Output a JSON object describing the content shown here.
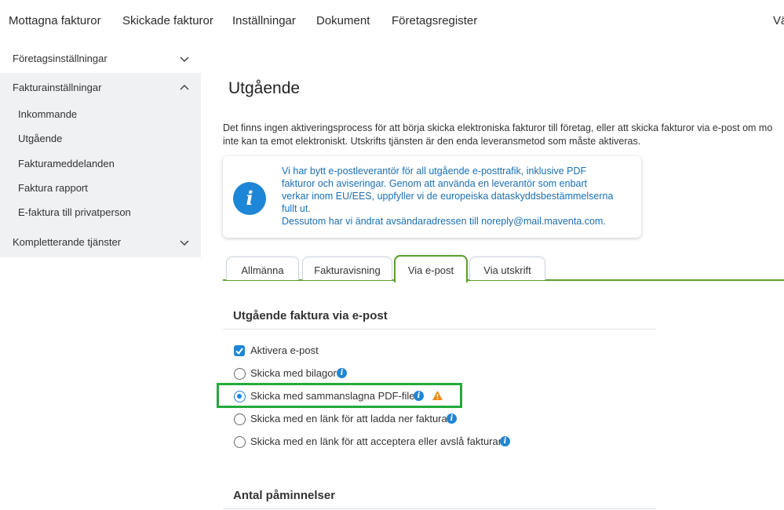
{
  "topnav": {
    "items": [
      "Mottagna fakturor",
      "Skickade fakturor",
      "Inställningar",
      "Dokument",
      "Företagsregister",
      "Vä"
    ]
  },
  "sidebar": {
    "groups": [
      {
        "label": "Företagsinställningar",
        "expanded": false
      },
      {
        "label": "Fakturainställningar",
        "expanded": true
      },
      {
        "label": "Kompletterande tjänster",
        "expanded": false
      }
    ],
    "sub_items": [
      "Inkommande",
      "Utgående",
      "Fakturameddelanden",
      "Faktura rapport",
      "E-faktura till privatperson"
    ]
  },
  "main": {
    "title": "Utgående",
    "intro_line1": "Det finns ingen aktiveringsprocess för att börja skicka elektroniska fakturor till företag, eller att skicka fakturor via e-post om mo",
    "intro_line2": "inte kan ta emot elektroniskt. Utskrifts tjänsten är den enda leveransmetod som måste aktiveras.",
    "notice": {
      "icon": "info-icon",
      "line1": "Vi har bytt e-postleverantör för all utgående e-posttrafik, inklusive PDF",
      "line2": "fakturor och aviseringar. Genom att använda en leverantör som enbart",
      "line3": "verkar inom EU/EES, uppfyller vi de europeiska dataskyddsbestämmelserna",
      "line4": "fullt ut.",
      "line5": "Dessutom har vi ändrat avsändaradressen till noreply@mail.maventa.com."
    },
    "tabs": [
      {
        "label": "Allmänna",
        "active": false
      },
      {
        "label": "Fakturavisning",
        "active": false
      },
      {
        "label": "Via e-post",
        "active": true
      },
      {
        "label": "Via utskrift",
        "active": false
      }
    ],
    "section_title": "Utgående faktura via e-post",
    "activate_email": {
      "label": "Aktivera e-post",
      "checked": true
    },
    "options": [
      {
        "label": "Skicka med bilagor",
        "selected": false,
        "has_info": true
      },
      {
        "label": "Skicka med sammanslagna PDF-filer",
        "selected": true,
        "has_info": true,
        "has_warning": true
      },
      {
        "label": "Skicka med en länk för att ladda ner faktura",
        "selected": false,
        "has_info": true
      },
      {
        "label": "Skicka med en länk för att acceptera eller avslå fakturan",
        "selected": false,
        "has_info": true
      }
    ],
    "section2_title": "Antal påminnelser"
  },
  "colors": {
    "accent_blue": "#1e86d6",
    "tab_green": "#5aa02c",
    "highlight_green": "#22aa3a",
    "warning_orange": "#f08a1c"
  }
}
